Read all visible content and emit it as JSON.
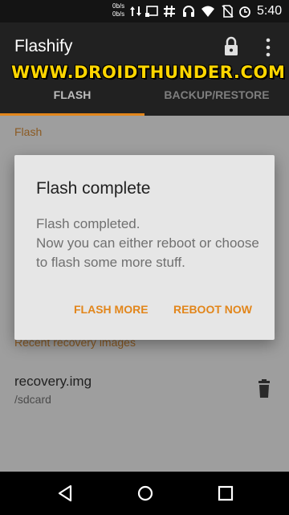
{
  "status_bar": {
    "speed_up": "0b/s",
    "speed_down": "0b/s",
    "time": "5:40",
    "icons": [
      "data-arrows-icon",
      "cast-icon",
      "hash-icon",
      "headphones-icon",
      "wifi-icon",
      "no-sim-icon",
      "alarm-icon"
    ]
  },
  "app": {
    "title": "Flashify",
    "watermark": "WWW.DROIDTHUNDER.COM",
    "tabs": [
      {
        "label": "FLASH",
        "active": true
      },
      {
        "label": "BACKUP/RESTORE",
        "active": false
      }
    ]
  },
  "content": {
    "section_flash": "Flash",
    "section_recent": "Recent recovery images",
    "recent_file": {
      "name": "recovery.img",
      "path": "/sdcard"
    }
  },
  "dialog": {
    "title": "Flash complete",
    "message_line1": "Flash completed.",
    "message_line2": "Now you can either reboot or choose to flash some more stuff.",
    "button_flash_more": "FLASH MORE",
    "button_reboot": "REBOOT NOW"
  },
  "colors": {
    "accent": "#e2861b",
    "app_bar": "#212121",
    "dialog_bg": "#e6e6e6",
    "watermark": "#ffd600"
  }
}
